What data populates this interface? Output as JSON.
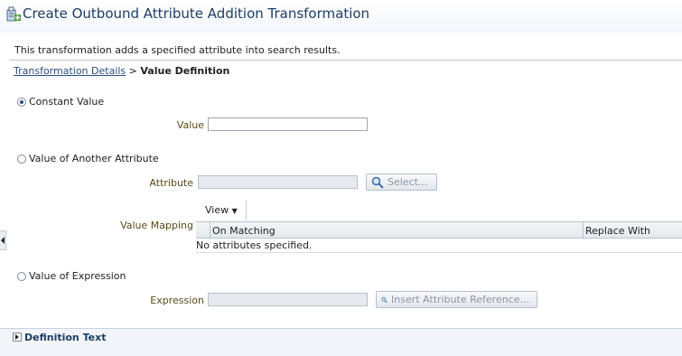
{
  "header": {
    "title": "Create Outbound Attribute Addition Transformation",
    "icon": "transformation-icon"
  },
  "description": "This transformation adds a specified attribute into search results.",
  "breadcrumb": {
    "link": "Transformation Details",
    "separator": ">",
    "current": "Value Definition"
  },
  "options": {
    "constant": {
      "label": "Constant Value",
      "selected": true,
      "value_label": "Value",
      "value": ""
    },
    "attribute": {
      "label": "Value of Another Attribute",
      "selected": false,
      "attribute_label": "Attribute",
      "attribute_value": "",
      "select_button": "Select...",
      "value_mapping_label": "Value Mapping",
      "view_menu": "View",
      "columns": [
        "On Matching",
        "Replace With"
      ],
      "empty_text": "No attributes specified."
    },
    "expression": {
      "label": "Value of Expression",
      "selected": false,
      "expression_label": "Expression",
      "expression_value": "",
      "insert_button": "Insert Attribute Reference..."
    }
  },
  "footer": {
    "definition_text": "Definition Text",
    "expanded": false
  },
  "colors": {
    "title": "#1d3d63",
    "link": "#2a4e80",
    "field_label": "#5a4a18"
  }
}
